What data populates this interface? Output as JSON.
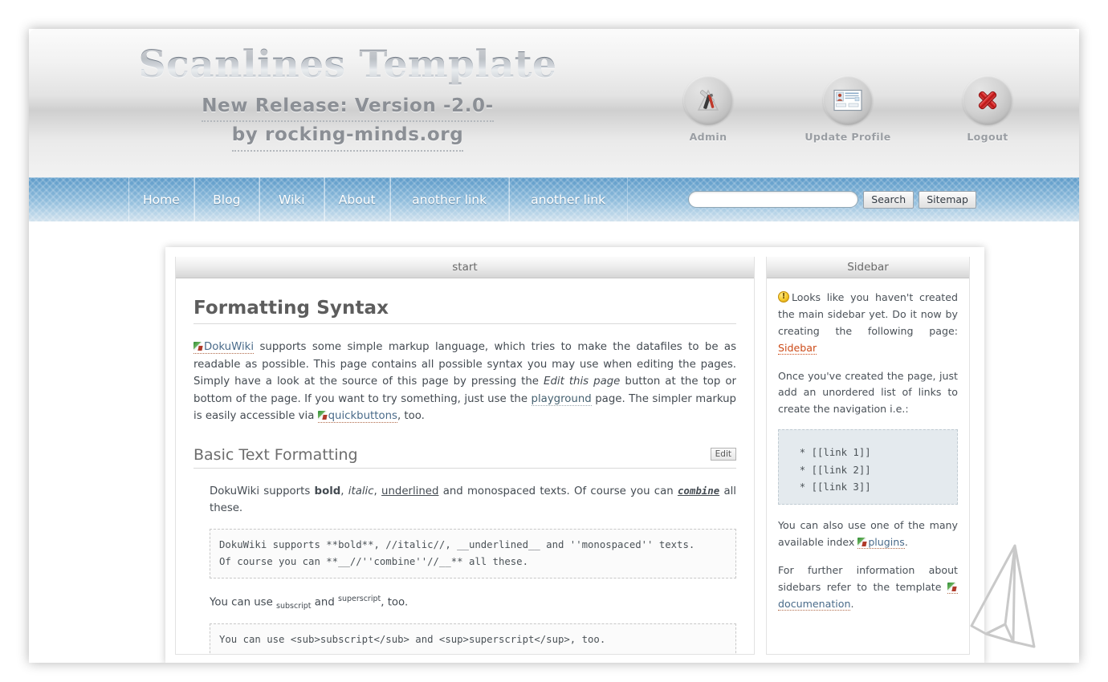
{
  "header": {
    "site_title": "Scanlines Template",
    "subtitle_line1": "New Release: Version -2.0-",
    "subtitle_line2": "by rocking-minds.org",
    "actions": [
      {
        "label": "Admin",
        "icon": "tools-icon"
      },
      {
        "label": "Update Profile",
        "icon": "id-card-icon"
      },
      {
        "label": "Logout",
        "icon": "red-x-icon"
      }
    ]
  },
  "nav": {
    "items": [
      {
        "label": "Home"
      },
      {
        "label": "Blog"
      },
      {
        "label": "Wiki"
      },
      {
        "label": "About"
      },
      {
        "label": "another link"
      },
      {
        "label": "another link"
      }
    ],
    "search_value": "",
    "search_placeholder": "",
    "search_button": "Search",
    "sitemap_button": "Sitemap"
  },
  "content": {
    "panel_title": "start",
    "h1": "Formatting Syntax",
    "intro": {
      "link_dokuwiki": "DokuWiki",
      "part1": " supports some simple markup language, which tries to make the datafiles to be as readable as possible. This page contains all possible syntax you may use when editing the pages. Simply have a look at the source of this page by pressing the ",
      "em_edit": "Edit this page",
      "part2": " button at the top or bottom of the page. If you want to try something, just use the ",
      "link_playground": "playground",
      "part3": " page. The simpler markup is easily accessible via ",
      "link_quickbuttons": "quickbuttons",
      "part4": ", too."
    },
    "h2": "Basic Text Formatting",
    "edit_label": "Edit",
    "fmt_para": {
      "p1": "DokuWiki supports ",
      "bold": "bold",
      "p2": ", ",
      "italic": "italic",
      "p3": ", ",
      "underline": "underlined",
      "p4": " and monospaced texts. Of course you can ",
      "combine": "combine",
      "p5": " all these."
    },
    "code1": "DokuWiki supports **bold**, //italic//, __underlined__ and ''monospaced'' texts.\nOf course you can **__//''combine''//__** all these.",
    "subsup_para": {
      "p1": "You can use ",
      "sub": "subscript",
      "p2": " and ",
      "sup": "superscript",
      "p3": ", too."
    },
    "code2": "You can use <sub>subscript</sub> and <sup>superscript</sup>, too."
  },
  "sidebar": {
    "panel_title": "Sidebar",
    "warn_text": "Looks like you haven't created the main sidebar yet. Do it now by creating the following page: ",
    "warn_link": "Sidebar",
    "para2": "Once you've created the page, just add an unordered list of links to create the navigation i.e.:",
    "code": "  * [[link 1]]\n  * [[link 2]]\n  * [[link 3]]",
    "para3_pre": "You can also use one of the many available index ",
    "para3_link": "plugins",
    "para3_post": ".",
    "para4_pre": "For further information about sidebars refer to the template ",
    "para4_link": "documenation",
    "para4_post": "."
  },
  "colors": {
    "nav_blue": "#6ea6cf",
    "link_blue": "#4a6b8a",
    "new_link_red": "#cc4a17",
    "heading_gray": "#5d5d5d",
    "warn_yellow": "#f8cf33"
  }
}
